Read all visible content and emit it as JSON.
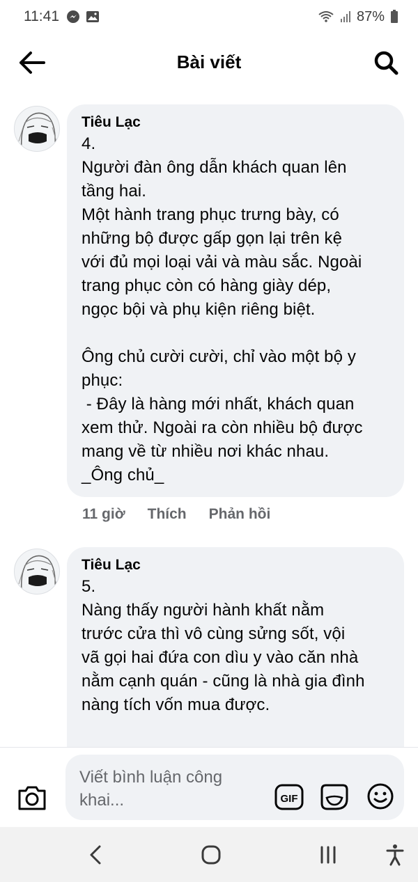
{
  "status_bar": {
    "time": "11:41",
    "battery": "87%"
  },
  "header": {
    "title": "Bài viết"
  },
  "comments": [
    {
      "author": "Tiêu Lạc",
      "text": "4.\nNgười đàn ông dẫn khách quan lên\ntầng hai.\nMột hành trang phục trưng bày, có\nnhững bộ được gấp gọn lại trên kệ\nvới đủ mọi loại vải và màu sắc. Ngoài\ntrang phục còn có hàng giày dép,\nngọc bội và phụ kiện riêng biệt.\n\nÔng chủ cười cười, chỉ vào một bộ y\nphục:\n - Đây là hàng mới nhất, khách quan\nxem thử. Ngoài ra còn nhiều bộ được\nmang về từ nhiều nơi khác nhau.\n_Ông chủ_",
      "time": "11 giờ",
      "like_label": "Thích",
      "reply_label": "Phản hồi"
    },
    {
      "author": "Tiêu Lạc",
      "text": "5.\nNàng thấy người hành khất nằm\ntrước cửa thì vô cùng sửng sốt, vội\nvã gọi hai đứa con dìu y vào căn nhà\nnằm cạnh quán - cũng là nhà gia đình\nnàng tích vốn mua được."
    }
  ],
  "composer": {
    "placeholder": "Viết bình luận công khai...",
    "gif_label": "GIF"
  },
  "icons": {
    "back": "arrow-left-icon",
    "search": "search-icon",
    "camera": "camera-icon",
    "gif": "gif-icon",
    "sticker": "sticker-icon",
    "emoji": "emoji-icon",
    "nav_back": "chevron-left-icon",
    "nav_home": "home-icon",
    "nav_recents": "recents-icon",
    "nav_accessibility": "accessibility-icon"
  },
  "colors": {
    "bubble": "#f0f2f5",
    "secondary_text": "#65676b",
    "primary_text": "#050505"
  }
}
